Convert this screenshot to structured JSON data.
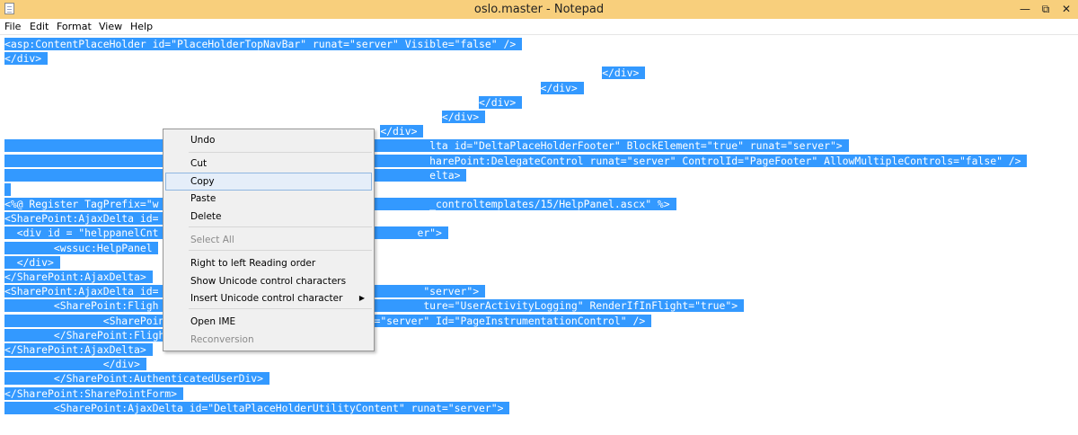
{
  "window": {
    "title": "oslo.master - Notepad",
    "minimize": "—",
    "restore": "⧉",
    "close": "✕"
  },
  "menu": [
    "File",
    "Edit",
    "Format",
    "View",
    "Help"
  ],
  "editor": {
    "lines": [
      [
        "",
        "<asp:ContentPlaceHolder id=\"PlaceHolderTopNavBar\" runat=\"server\" Visible=\"false\" />"
      ],
      [
        "",
        "</div>"
      ],
      [
        "                                                                                                 ",
        "</div>"
      ],
      [
        "                                                                                       ",
        "</div>"
      ],
      [
        "                                                                             ",
        "</div>"
      ],
      [
        "                                                                       ",
        "</div>"
      ],
      [
        "                                                             ",
        "</div>"
      ],
      [
        "",
        "                                                                     lta id=\"DeltaPlaceHolderFooter\" BlockElement=\"true\" runat=\"server\">"
      ],
      [
        "",
        "                                                                     harePoint:DelegateControl runat=\"server\" ControlId=\"PageFooter\" AllowMultipleControls=\"false\" />"
      ],
      [
        "",
        "                                                                     elta>"
      ],
      [
        "",
        ""
      ],
      [
        "",
        "<%@ Register TagPrefix=\"w                                            _controltemplates/15/HelpPanel.ascx\" %>"
      ],
      [
        "",
        "<SharePoint:AjaxDelta id="
      ],
      [
        "",
        "  <div id = \"helppanelCnt                                          er\">"
      ],
      [
        "",
        "        <wssuc:HelpPanel"
      ],
      [
        "",
        "  </div>"
      ],
      [
        "",
        "</SharePoint:AjaxDelta>"
      ],
      [
        "",
        "<SharePoint:AjaxDelta id=                                           \"server\">"
      ],
      [
        "",
        "        <SharePoint:Fligh                                           ture=\"UserActivityLogging\" RenderIfInFlight=\"true\">"
      ],
      [
        "",
        "                <SharePoint:PageInstrumentationControl runat=\"server\" Id=\"PageInstrumentationControl\" />"
      ],
      [
        "",
        "        </SharePoint:FlightedContent>"
      ],
      [
        "",
        "</SharePoint:AjaxDelta>"
      ],
      [
        "",
        "                </div>"
      ],
      [
        "",
        "        </SharePoint:AuthenticatedUserDiv>"
      ],
      [
        "",
        "</SharePoint:SharePointForm>"
      ],
      [
        "",
        "        <SharePoint:AjaxDelta id=\"DeltaPlaceHolderUtilityContent\" runat=\"server\">"
      ]
    ]
  },
  "context_menu": {
    "items": [
      {
        "label": "Undo",
        "enabled": true
      },
      {
        "label": "Cut",
        "enabled": true
      },
      {
        "label": "Copy",
        "enabled": true,
        "highlighted": true
      },
      {
        "label": "Paste",
        "enabled": true
      },
      {
        "label": "Delete",
        "enabled": true
      },
      {
        "label": "Select All",
        "enabled": false
      },
      {
        "label": "Right to left Reading order",
        "enabled": true
      },
      {
        "label": "Show Unicode control characters",
        "enabled": true
      },
      {
        "label": "Insert Unicode control character",
        "enabled": true,
        "submenu": true
      },
      {
        "label": "Open IME",
        "enabled": true
      },
      {
        "label": "Reconversion",
        "enabled": false
      }
    ]
  },
  "colors": {
    "titlebar": "#f8cf7c",
    "selection": "#3399ff",
    "menu_bg": "#f0f0f0"
  }
}
